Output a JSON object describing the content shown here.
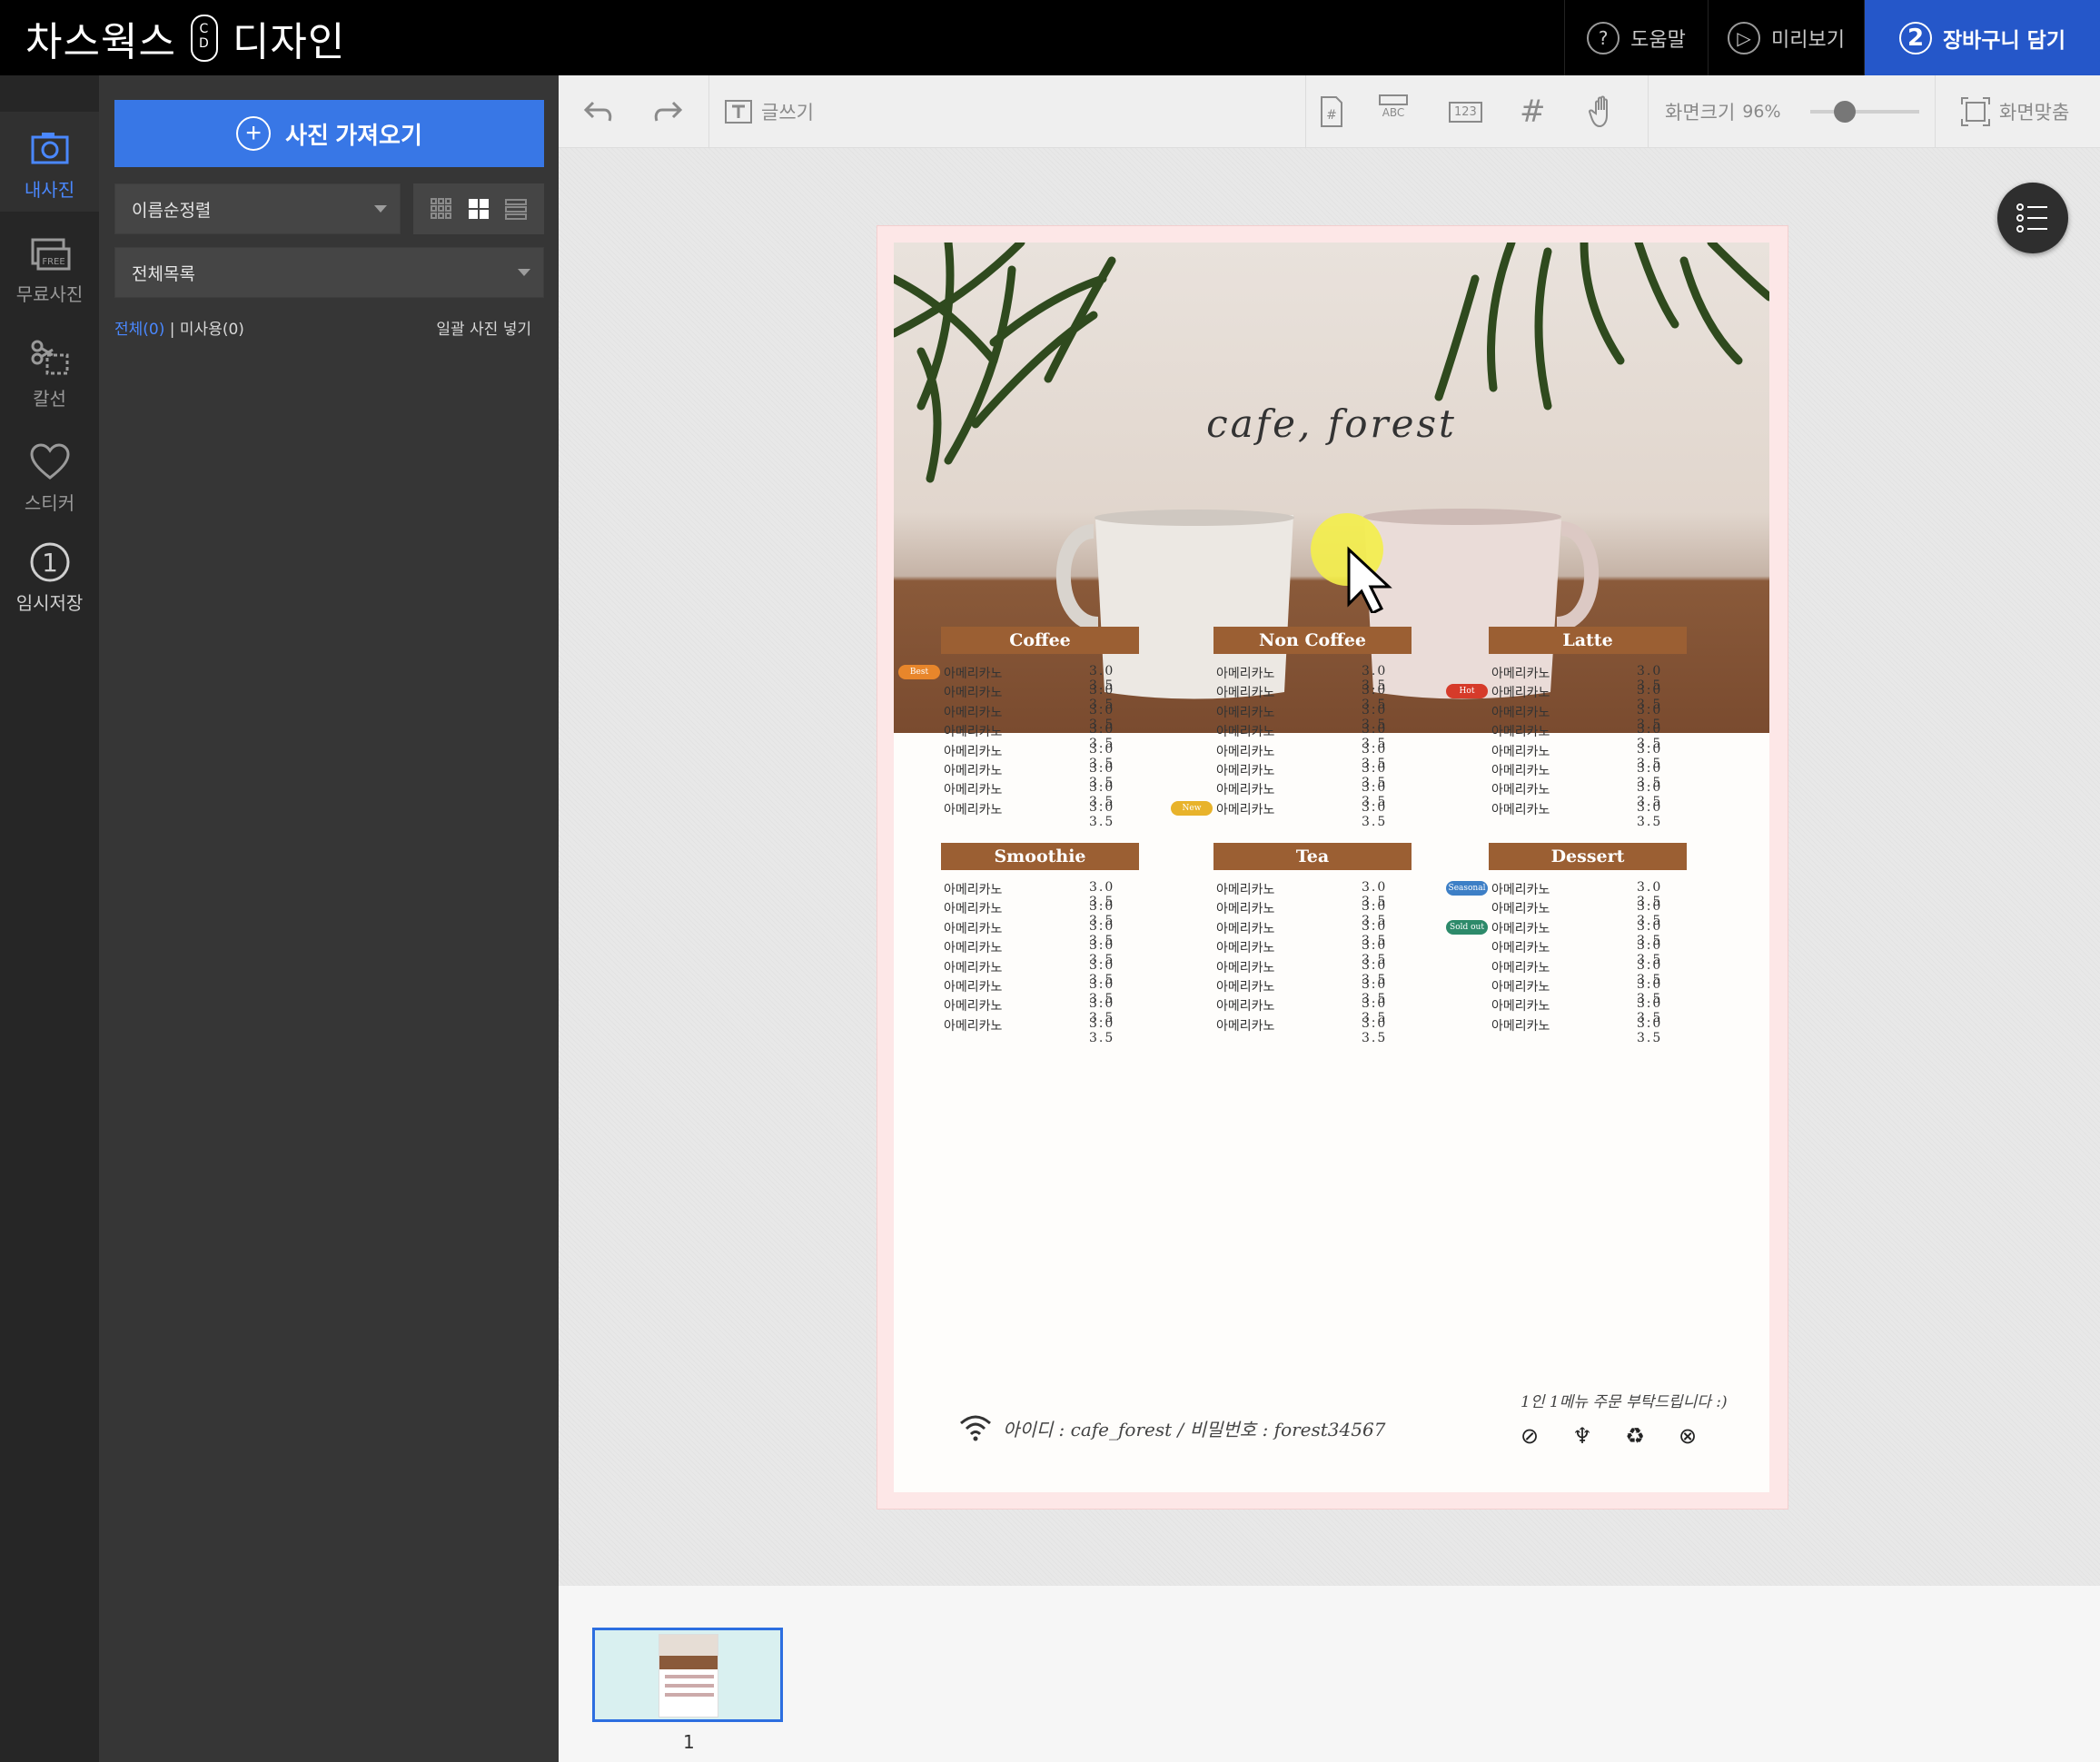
{
  "app": {
    "logo_left": "차스웍스",
    "logo_mark": "C D",
    "logo_right": "디자인"
  },
  "topbar": {
    "help": {
      "icon": "?",
      "label": "도움말"
    },
    "preview": {
      "icon": "▷",
      "label": "미리보기"
    },
    "cart": {
      "icon": "2",
      "label": "장바구니 담기"
    }
  },
  "rail": [
    {
      "label": "내사진",
      "icon": "camera-icon",
      "active": true
    },
    {
      "label": "무료사진",
      "icon": "free-photo-icon",
      "active": false
    },
    {
      "label": "칼선",
      "icon": "scissors-icon",
      "active": false
    },
    {
      "label": "스티커",
      "icon": "heart-icon",
      "active": false
    },
    {
      "label": "임시저장",
      "icon": "temp-save-1-icon",
      "active": false
    }
  ],
  "rail_temp_badge": "1",
  "panel": {
    "import_label": "사진 가져오기",
    "sort_value": "이름순정렬",
    "folder_value": "전체목록",
    "filter_all": "전체(0)",
    "filter_sep": "|",
    "filter_unused": "미사용(0)",
    "bulk_insert": "일괄 사진 넣기"
  },
  "toolbar": {
    "text_tool": "글쓰기",
    "zoom_label": "화면크기",
    "zoom_value": "96%",
    "fit_label": "화면맞춤",
    "icon_labels": {
      "abc": "ABC",
      "num": "123",
      "hash": "#"
    }
  },
  "design": {
    "title": "cafe, forest",
    "sections": [
      {
        "name": "Coffee",
        "badges": {
          "0": {
            "text": "Best",
            "color": "#e8862b"
          }
        }
      },
      {
        "name": "Non Coffee",
        "badges": {
          "7": {
            "text": "New",
            "color": "#e8b32b"
          }
        }
      },
      {
        "name": "Latte",
        "badges": {
          "1": {
            "text": "Hot",
            "color": "#d63b2a"
          }
        }
      },
      {
        "name": "Smoothie",
        "badges": {}
      },
      {
        "name": "Tea",
        "badges": {}
      },
      {
        "name": "Dessert",
        "badges": {
          "0": {
            "text": "Seasonal",
            "color": "#3d7fc6"
          },
          "2": {
            "text": "Sold out",
            "color": "#2d8a6a"
          }
        }
      }
    ],
    "item_name": "아메리카노",
    "price_small": "3.0",
    "price_large": "3.5",
    "rows_per_section": 8,
    "wifi_text": "아이디 : cafe_forest / 비밀번호 : forest34567",
    "note": "1인 1메뉴 주문 부탁드립니다 :)",
    "policy_icons": [
      "no-outside-food-icon",
      "takeout-cup-icon",
      "recycle-icon",
      "no-pets-icon"
    ]
  },
  "pages": [
    {
      "number": "1"
    }
  ],
  "colors": {
    "accent": "#3877e6",
    "cart": "#2557c9",
    "menu_header": "#9b5f33",
    "page_border": "#fde7e7"
  }
}
